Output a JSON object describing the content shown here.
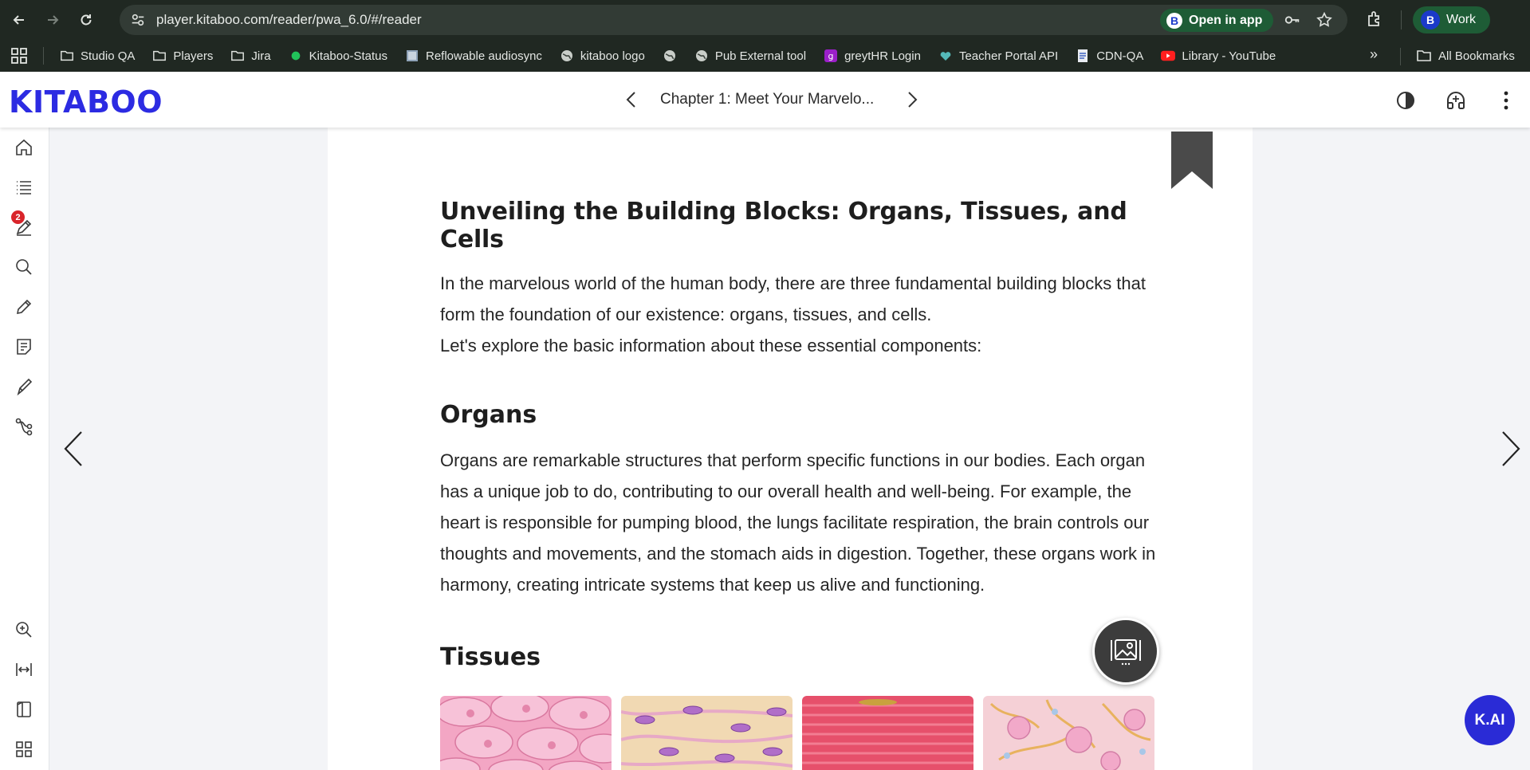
{
  "browser": {
    "url": "player.kitaboo.com/reader/pwa_6.0/#/reader",
    "open_in_app": "Open in app",
    "profile_name": "Work",
    "profile_initial": "B",
    "bookmarks": [
      {
        "label": "Studio QA",
        "icon": "folder-icon"
      },
      {
        "label": "Players",
        "icon": "folder-icon"
      },
      {
        "label": "Jira",
        "icon": "folder-icon"
      },
      {
        "label": "Kitaboo-Status",
        "icon": "status-dot-icon"
      },
      {
        "label": "Reflowable audiosync",
        "icon": "image-icon"
      },
      {
        "label": "kitaboo logo",
        "icon": "globe-icon"
      },
      {
        "label": "",
        "icon": "globe-icon"
      },
      {
        "label": "Pub External tool",
        "icon": "globe-icon"
      },
      {
        "label": "greytHR Login",
        "icon": "greythr-icon"
      },
      {
        "label": "Teacher Portal API",
        "icon": "heart-icon"
      },
      {
        "label": "CDN-QA",
        "icon": "doc-icon"
      },
      {
        "label": "Library - YouTube",
        "icon": "youtube-icon"
      }
    ],
    "more_bookmarks": "»",
    "all_bookmarks": "All Bookmarks"
  },
  "reader": {
    "logo": "KITABOO",
    "chapter_title": "Chapter 1: Meet Your Marvelo...",
    "notification_count": "2",
    "kai_label": "K.AI",
    "accent_color": "#2c2be2"
  },
  "content": {
    "title": "Unveiling the Building Blocks: Organs, Tissues, and Cells",
    "intro": "In the marvelous world of the human body, there are three fundamental building blocks that form the foundation of our existence: organs, tissues, and cells.",
    "intro2": "Let's explore the basic information about these essential components:",
    "organs_heading": "Organs",
    "organs_text": "Organs are remarkable structures that perform specific functions in our bodies. Each organ has a unique job to do, contributing to our overall health and well-being. For example, the heart is responsible for pumping blood, the lungs facilitate respiration, the brain controls our thoughts and movements, and the stomach aids in digestion. Together, these organs work in harmony, creating intricate systems that keep us alive and functioning.",
    "tissues_heading": "Tissues"
  }
}
